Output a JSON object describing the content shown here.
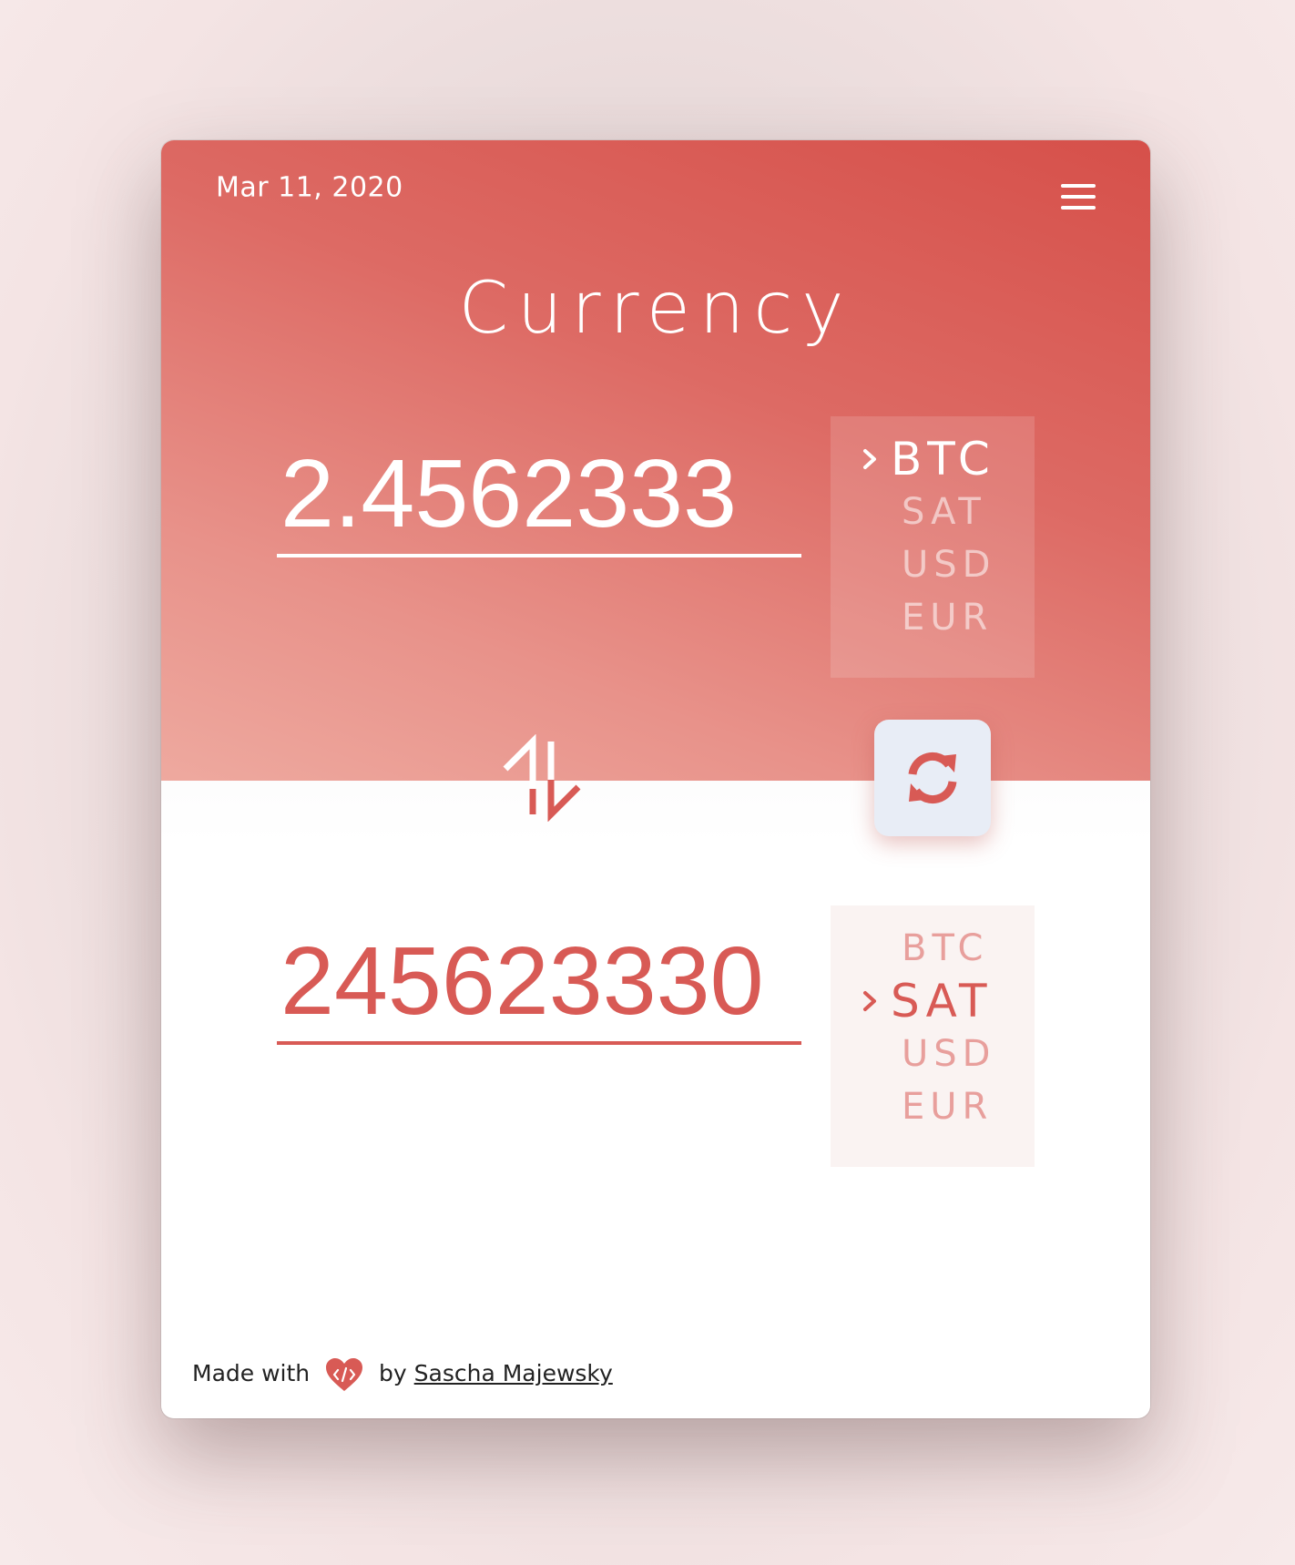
{
  "header": {
    "date": "Mar 11, 2020",
    "title": "Currency"
  },
  "input": {
    "value": "2.4562333",
    "units": [
      "BTC",
      "SAT",
      "USD",
      "EUR"
    ],
    "selected_unit": "BTC"
  },
  "output": {
    "value": "245623330",
    "units": [
      "BTC",
      "SAT",
      "USD",
      "EUR"
    ],
    "selected_unit": "SAT"
  },
  "icons": {
    "menu": "hamburger-menu-icon",
    "swap": "swap-arrows-icon",
    "refresh": "refresh-icon",
    "heart": "heart-code-icon",
    "chevron": "chevron-right-icon"
  },
  "colors": {
    "accent": "#d85a55",
    "header_gradient_top": "#d6504a",
    "header_gradient_bottom": "#eea99f",
    "button_bg": "#e8edf6"
  },
  "footer": {
    "made_with": "Made with",
    "by": "by",
    "author": "Sascha Majewsky"
  }
}
